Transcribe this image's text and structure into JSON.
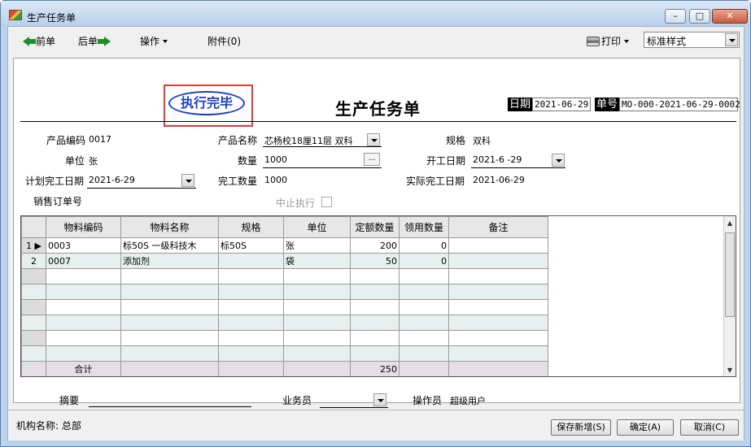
{
  "window": {
    "title": "生产任务单",
    "buttons": [
      "–",
      "□",
      "✕"
    ]
  },
  "toolbar": {
    "prev": "前单",
    "next": "后单",
    "ops": "操作",
    "attach": "附件(0)",
    "print": "打印",
    "style": "标准样式"
  },
  "header": {
    "seal": "执行完毕",
    "title": "生产任务单",
    "date_label": "日期",
    "date": "2021-06-29",
    "no_label": "单号",
    "no": "MO-000-2021-06-29-0002"
  },
  "fields": {
    "product_code_label": "产品编码",
    "product_code": "0017",
    "product_name_label": "产品名称",
    "product_name": "芯杨校18厘11层  双科",
    "spec_label": "规格",
    "spec": "双科",
    "unit_label": "单位",
    "unit": "张",
    "qty_label": "数量",
    "qty": "1000",
    "start_label": "开工日期",
    "start": "2021-6 -29",
    "plan_end_label": "计划完工日期",
    "plan_end": "2021-6-29",
    "done_qty_label": "完工数量",
    "done_qty": "1000",
    "actual_end_label": "实际完工日期",
    "actual_end": "2021-06-29",
    "so_label": "销售订单号",
    "stop_label": "中止执行"
  },
  "grid": {
    "headers": [
      "物料编码",
      "物料名称",
      "规格",
      "单位",
      "定额数量",
      "领用数量",
      "备注"
    ],
    "rows": [
      [
        "0003",
        "标50S  一级科技木",
        "标50S",
        "张",
        "200",
        "0",
        ""
      ],
      [
        "0007",
        "添加剂",
        "",
        "袋",
        "50",
        "0",
        ""
      ]
    ],
    "row_labels": [
      "1",
      "2"
    ],
    "total_label": "合计",
    "total_qty": "250"
  },
  "footer": {
    "summary_label": "摘要",
    "clerk_label": "业务员",
    "operator_label": "操作员",
    "operator": "超级用户"
  },
  "status": {
    "org": "机构名称: 总部",
    "save_new": "保存新增(S)",
    "ok": "确定(A)",
    "cancel": "取消(C)"
  }
}
